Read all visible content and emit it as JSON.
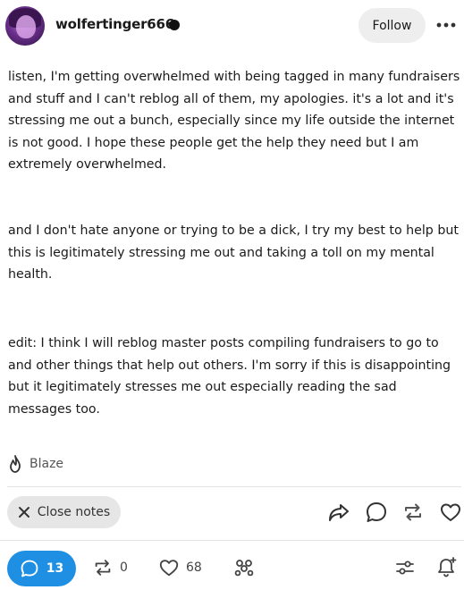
{
  "post": {
    "username": "wolfertinger666",
    "follow_label": "Follow",
    "paragraphs": [
      "listen, I'm getting overwhelmed with being tagged in many fundraisers and stuff and I can't reblog all of them, my apologies. it's a lot and it's stressing me out a bunch, especially since my life outside the internet is not good. I hope these people get the help they need but I am extremely overwhelmed.",
      "and I don't hate anyone or trying to be a dick, I try my best to help but this is legitimately stressing me out and taking a toll on my mental health.",
      "edit: I think I will reblog master posts compiling fundraisers to go to and other things that help out others. I'm sorry if this is disappointing but it legitimately stresses me out especially reading the sad messages too."
    ],
    "blaze_label": "Blaze",
    "close_notes_label": "Close notes"
  },
  "footer": {
    "notes_count": "13",
    "reblogs_count": "0",
    "likes_count": "68"
  },
  "colors": {
    "accent": "#1e8fe3",
    "pill_bg": "#e6e6e6",
    "text": "#1a1a1a"
  },
  "icons": {
    "more": "more-dots-icon",
    "blaze": "flame-icon",
    "close": "close-x-icon",
    "share": "share-arrow-icon",
    "reply": "speech-bubble-icon",
    "reblog": "reblog-arrows-icon",
    "like": "heart-icon",
    "notes": "speech-bubble-icon",
    "reactions": "reaction-circles-icon",
    "filter": "sliders-icon",
    "notify": "bell-plus-icon"
  }
}
